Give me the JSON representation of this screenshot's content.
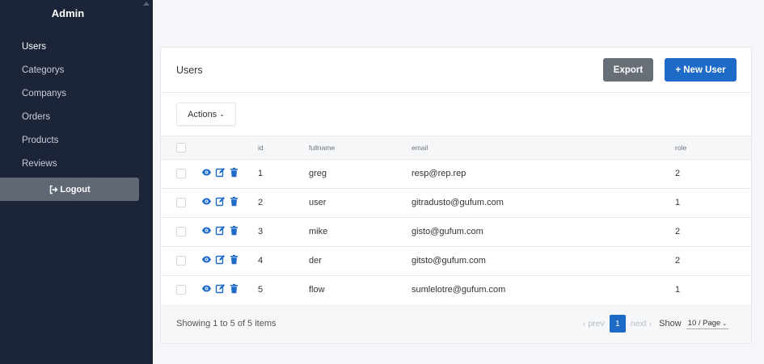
{
  "app": {
    "brand": "Admin"
  },
  "sidebar": {
    "items": [
      {
        "label": "Users",
        "active": true
      },
      {
        "label": "Categorys",
        "active": false
      },
      {
        "label": "Companys",
        "active": false
      },
      {
        "label": "Orders",
        "active": false
      },
      {
        "label": "Products",
        "active": false
      },
      {
        "label": "Reviews",
        "active": false
      }
    ],
    "logout_label": "Logout",
    "logout_icon": "sign-out-icon"
  },
  "card": {
    "title": "Users",
    "export_label": "Export",
    "new_user_label": "+ New User",
    "actions_label": "Actions",
    "actions_icon": "chevron-down-icon"
  },
  "table": {
    "columns": [
      "id",
      "fullname",
      "email",
      "role"
    ],
    "rows": [
      {
        "id": "1",
        "fullname": "greg",
        "email": "resp@rep.rep",
        "role": "2"
      },
      {
        "id": "2",
        "fullname": "user",
        "email": "gitradusto@gufum.com",
        "role": "1"
      },
      {
        "id": "3",
        "fullname": "mike",
        "email": "gisto@gufum.com",
        "role": "2"
      },
      {
        "id": "4",
        "fullname": "der",
        "email": "gitsto@gufum.com",
        "role": "2"
      },
      {
        "id": "5",
        "fullname": "flow",
        "email": "sumlelotre@gufum.com",
        "role": "1"
      }
    ],
    "row_icons": [
      "eye-icon",
      "edit-icon",
      "trash-icon"
    ]
  },
  "footer": {
    "showing": "Showing 1 to 5 of 5 items",
    "prev": "prev",
    "next": "next",
    "current_page": "1",
    "show_label": "Show",
    "page_size": "10 / Page"
  },
  "colors": {
    "sidebar_bg": "#1c2438",
    "primary": "#1d6bc6",
    "export_bg": "#686e76",
    "logout_bg": "#606876"
  }
}
